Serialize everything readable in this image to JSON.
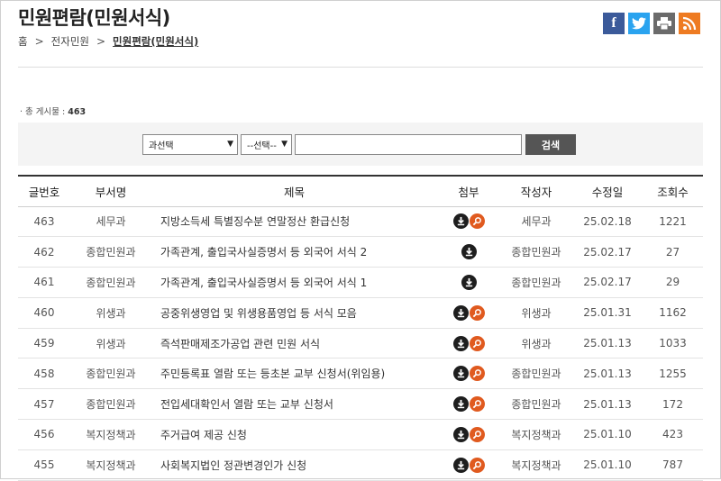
{
  "header": {
    "title": "민원편람(민원서식)",
    "breadcrumb": [
      "홈",
      "전자민원",
      "민원편람(민원서식)"
    ]
  },
  "share": [
    {
      "name": "facebook",
      "glyph": "f"
    },
    {
      "name": "twitter",
      "glyph": "t"
    },
    {
      "name": "print",
      "glyph": "print"
    },
    {
      "name": "rss",
      "glyph": "rss"
    }
  ],
  "total": {
    "label": "총 게시물 :",
    "count": "463"
  },
  "search": {
    "dept_select": "과선택",
    "field_select": "--선택--",
    "query": "",
    "button": "검색"
  },
  "table": {
    "headers": [
      "글번호",
      "부서명",
      "제목",
      "첨부",
      "작성자",
      "수정일",
      "조회수"
    ],
    "rows": [
      {
        "no": "463",
        "dept": "세무과",
        "title": "지방소득세 특별징수분 연말정산 환급신청",
        "attach": [
          "download",
          "view"
        ],
        "author": "세무과",
        "date": "25.02.18",
        "views": "1221"
      },
      {
        "no": "462",
        "dept": "종합민원과",
        "title": "가족관계, 출입국사실증명서 등 외국어 서식 2",
        "attach": [
          "download"
        ],
        "author": "종합민원과",
        "date": "25.02.17",
        "views": "27"
      },
      {
        "no": "461",
        "dept": "종합민원과",
        "title": "가족관계, 출입국사실증명서 등 외국어 서식 1",
        "attach": [
          "download"
        ],
        "author": "종합민원과",
        "date": "25.02.17",
        "views": "29"
      },
      {
        "no": "460",
        "dept": "위생과",
        "title": "공중위생영업 및 위생용품영업 등 서식 모음",
        "attach": [
          "download",
          "view"
        ],
        "author": "위생과",
        "date": "25.01.31",
        "views": "1162"
      },
      {
        "no": "459",
        "dept": "위생과",
        "title": "즉석판매제조가공업 관련 민원 서식",
        "attach": [
          "download",
          "view"
        ],
        "author": "위생과",
        "date": "25.01.13",
        "views": "1033"
      },
      {
        "no": "458",
        "dept": "종합민원과",
        "title": "주민등록표 열람 또는 등초본 교부 신청서(위임용)",
        "attach": [
          "download",
          "view"
        ],
        "author": "종합민원과",
        "date": "25.01.13",
        "views": "1255"
      },
      {
        "no": "457",
        "dept": "종합민원과",
        "title": "전입세대확인서 열람 또는 교부 신청서",
        "attach": [
          "download",
          "view"
        ],
        "author": "종합민원과",
        "date": "25.01.13",
        "views": "172"
      },
      {
        "no": "456",
        "dept": "복지정책과",
        "title": "주거급여 제공 신청",
        "attach": [
          "download",
          "view"
        ],
        "author": "복지정책과",
        "date": "25.01.10",
        "views": "423"
      },
      {
        "no": "455",
        "dept": "복지정책과",
        "title": "사회복지법인 정관변경인가 신청",
        "attach": [
          "download",
          "view"
        ],
        "author": "복지정책과",
        "date": "25.01.10",
        "views": "787"
      }
    ]
  }
}
